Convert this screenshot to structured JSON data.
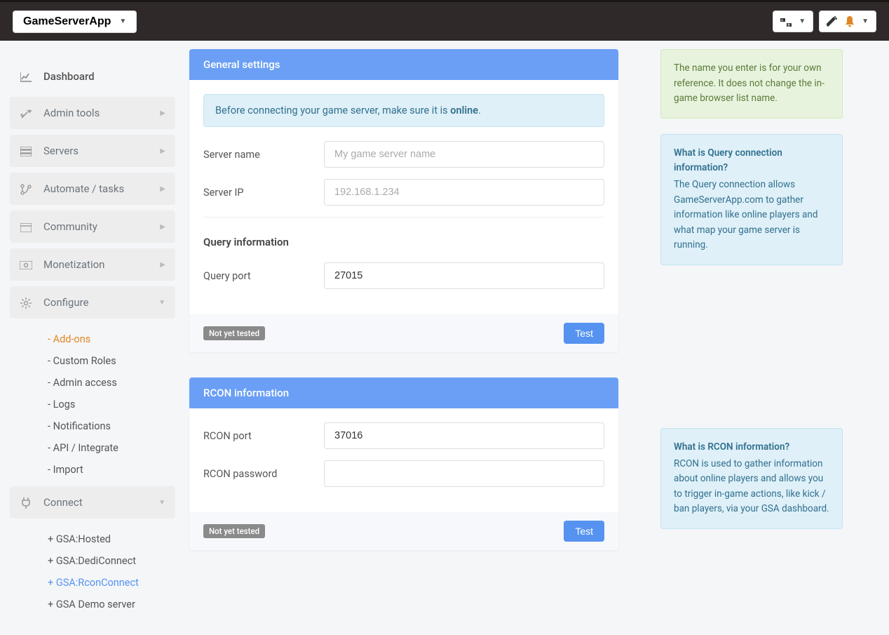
{
  "header": {
    "brand": "GameServerApp"
  },
  "sidebar": {
    "dashboard": "Dashboard",
    "groups": {
      "admin_tools": "Admin tools",
      "servers": "Servers",
      "automate": "Automate / tasks",
      "community": "Community",
      "monetization": "Monetization",
      "configure": "Configure",
      "connect": "Connect"
    },
    "configure_items": {
      "addons": "- Add-ons",
      "custom_roles": "- Custom Roles",
      "admin_access": "- Admin access",
      "logs": "- Logs",
      "notifications": "- Notifications",
      "api": "- API / Integrate",
      "import": "- Import"
    },
    "connect_items": {
      "hosted": "+ GSA:Hosted",
      "dediconnect": "+ GSA:DediConnect",
      "rconconnect": "+ GSA:RconConnect",
      "demo": "+ GSA Demo server"
    }
  },
  "general": {
    "title": "General settings",
    "alert_prefix": "Before connecting your game server, make sure it is ",
    "alert_bold": "online",
    "alert_suffix": ".",
    "server_name_label": "Server name",
    "server_name_placeholder": "My game server name",
    "server_name_value": "",
    "server_ip_label": "Server IP",
    "server_ip_placeholder": "192.168.1.234",
    "server_ip_value": "",
    "query_section": "Query information",
    "query_port_label": "Query port",
    "query_port_value": "27015",
    "status": "Not yet tested",
    "test_btn": "Test"
  },
  "rcon": {
    "title": "RCON information",
    "port_label": "RCON port",
    "port_value": "37016",
    "password_label": "RCON password",
    "password_value": "",
    "status": "Not yet tested",
    "test_btn": "Test"
  },
  "info": {
    "name_note": "The name you enter is for your own reference. It does not change the in-game browser list name.",
    "query_title": "What is Query connection information?",
    "query_body": "The Query connection allows GameServerApp.com to gather information like online players and what map your game server is running.",
    "rcon_title": "What is RCON information?",
    "rcon_body": "RCON is used to gather information about online players and allows you to trigger in-game actions, like kick / ban players, via your GSA dashboard."
  }
}
